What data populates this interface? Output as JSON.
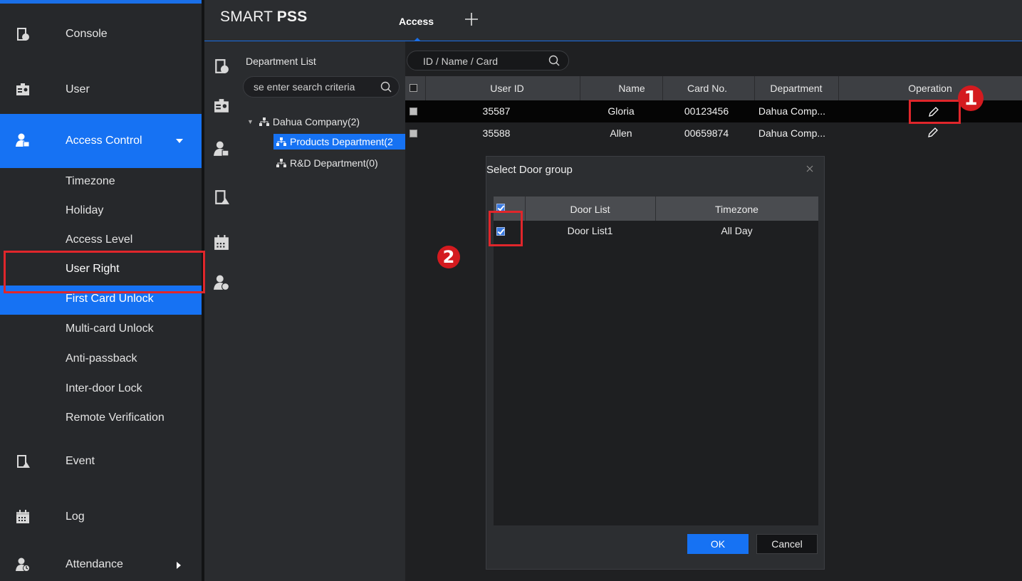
{
  "menu": {
    "console": "Console",
    "user": "User",
    "access_control": "Access Control",
    "sub_items": [
      "Timezone",
      "Holiday",
      "Access Level",
      "User Right",
      "First Card Unlock",
      "Multi-card Unlock",
      "Anti-passback",
      "Inter-door Lock",
      "Remote Verification"
    ],
    "event": "Event",
    "log": "Log",
    "attendance": "Attendance"
  },
  "header": {
    "brand_light": "SMART ",
    "brand_bold": "PSS",
    "tab": "Access"
  },
  "department": {
    "title": "Department List",
    "search_placeholder": "se enter search criteria",
    "tree": {
      "root": "Dahua Company(2)",
      "children": [
        "Products Department(2",
        "R&D Department(0)"
      ]
    }
  },
  "users": {
    "search_placeholder": "ID / Name / Card",
    "columns": [
      "User ID",
      "Name",
      "Card No.",
      "Department",
      "Operation"
    ],
    "rows": [
      {
        "id": "35587",
        "name": "Gloria",
        "card": "00123456",
        "dept": "Dahua Comp..."
      },
      {
        "id": "35588",
        "name": "Allen",
        "card": "00659874",
        "dept": "Dahua Comp..."
      }
    ]
  },
  "dialog": {
    "title": "Select Door group",
    "columns": [
      "Door  List",
      "Timezone"
    ],
    "rows": [
      {
        "door": "Door  List1",
        "timezone": "All Day"
      }
    ],
    "ok": "OK",
    "cancel": "Cancel"
  },
  "annotations": {
    "step1": "1",
    "step2": "2"
  },
  "watermark": "35587",
  "colors": {
    "accent": "#1672f3",
    "annotation": "#e0262b"
  }
}
